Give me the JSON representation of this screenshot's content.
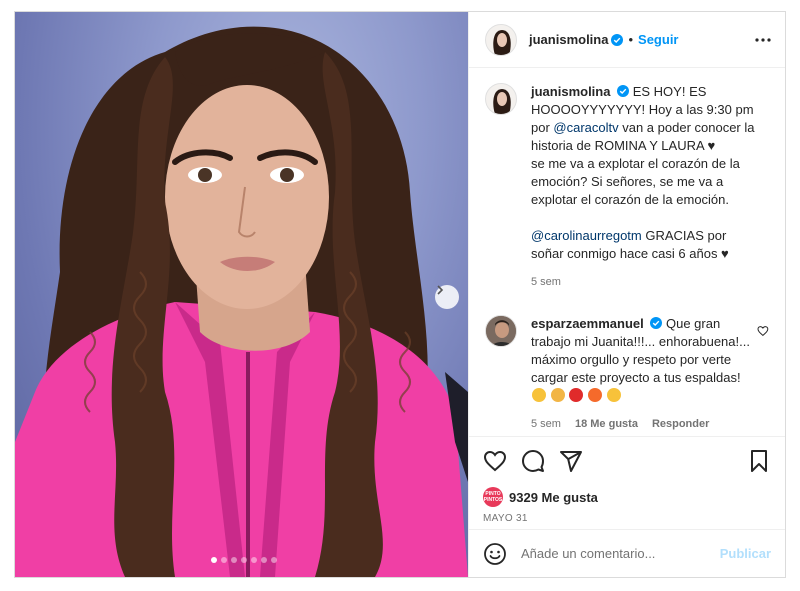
{
  "post": {
    "author": "juanismolina",
    "follow_label": "Seguir",
    "separator": "•",
    "caption": {
      "username": "juanismolina",
      "line1": "ES HOY! ES HOOOOYYYYYYY! Hoy a las 9:30 pm por ",
      "mention1": "@caracoltv",
      "line2": " van a poder conocer la historia de ROMINA Y LAURA ♥",
      "line3": "se me va a explotar el corazón de la emoción? Si señores, se me va a explotar el corazón de la emoción.",
      "mention2": "@carolinaurregotm",
      "line4": " GRACIAS por soñar conmigo hace casi 6 años ♥",
      "time": "5 sem"
    },
    "comment": {
      "username": "esparzaemmanuel",
      "text": "Que gran trabajo mi Juanita!!!... enhorabuena!... máximo orgullo y respeto por verte cargar este proyecto a tus espaldas!",
      "time": "5 sem",
      "likes": "18 Me gusta",
      "reply_label": "Responder"
    },
    "likes_label": "9329 Me gusta",
    "likes_avatar_text": "PINTO PINTOS",
    "date": "MAYO 31",
    "composer": {
      "placeholder": "Añade un comentario...",
      "publish_label": "Publicar"
    },
    "carousel": {
      "total": 7,
      "current": 1
    }
  },
  "colors": {
    "accent": "#0095f6",
    "verified": "#0095f6",
    "jacket": "#f03fa5",
    "background": "#7f8ac4"
  },
  "icons": [
    "verified-icon",
    "more-icon",
    "heart-icon",
    "comment-icon",
    "share-icon",
    "save-icon",
    "emoji-icon",
    "chevron-right-icon"
  ]
}
